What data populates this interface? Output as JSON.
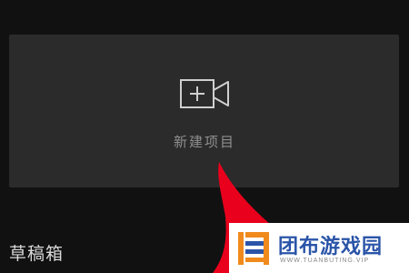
{
  "new_project": {
    "label": "新建项目",
    "icon": "video-camera-add-icon"
  },
  "drafts": {
    "title": "草稿箱"
  },
  "overlay": {
    "arrow_color": "#e8001c",
    "watermark_text": "团布游戏园",
    "watermark_url": "WWW.TUANBUTING.VIP",
    "watermark_color": "#2a54a8"
  }
}
